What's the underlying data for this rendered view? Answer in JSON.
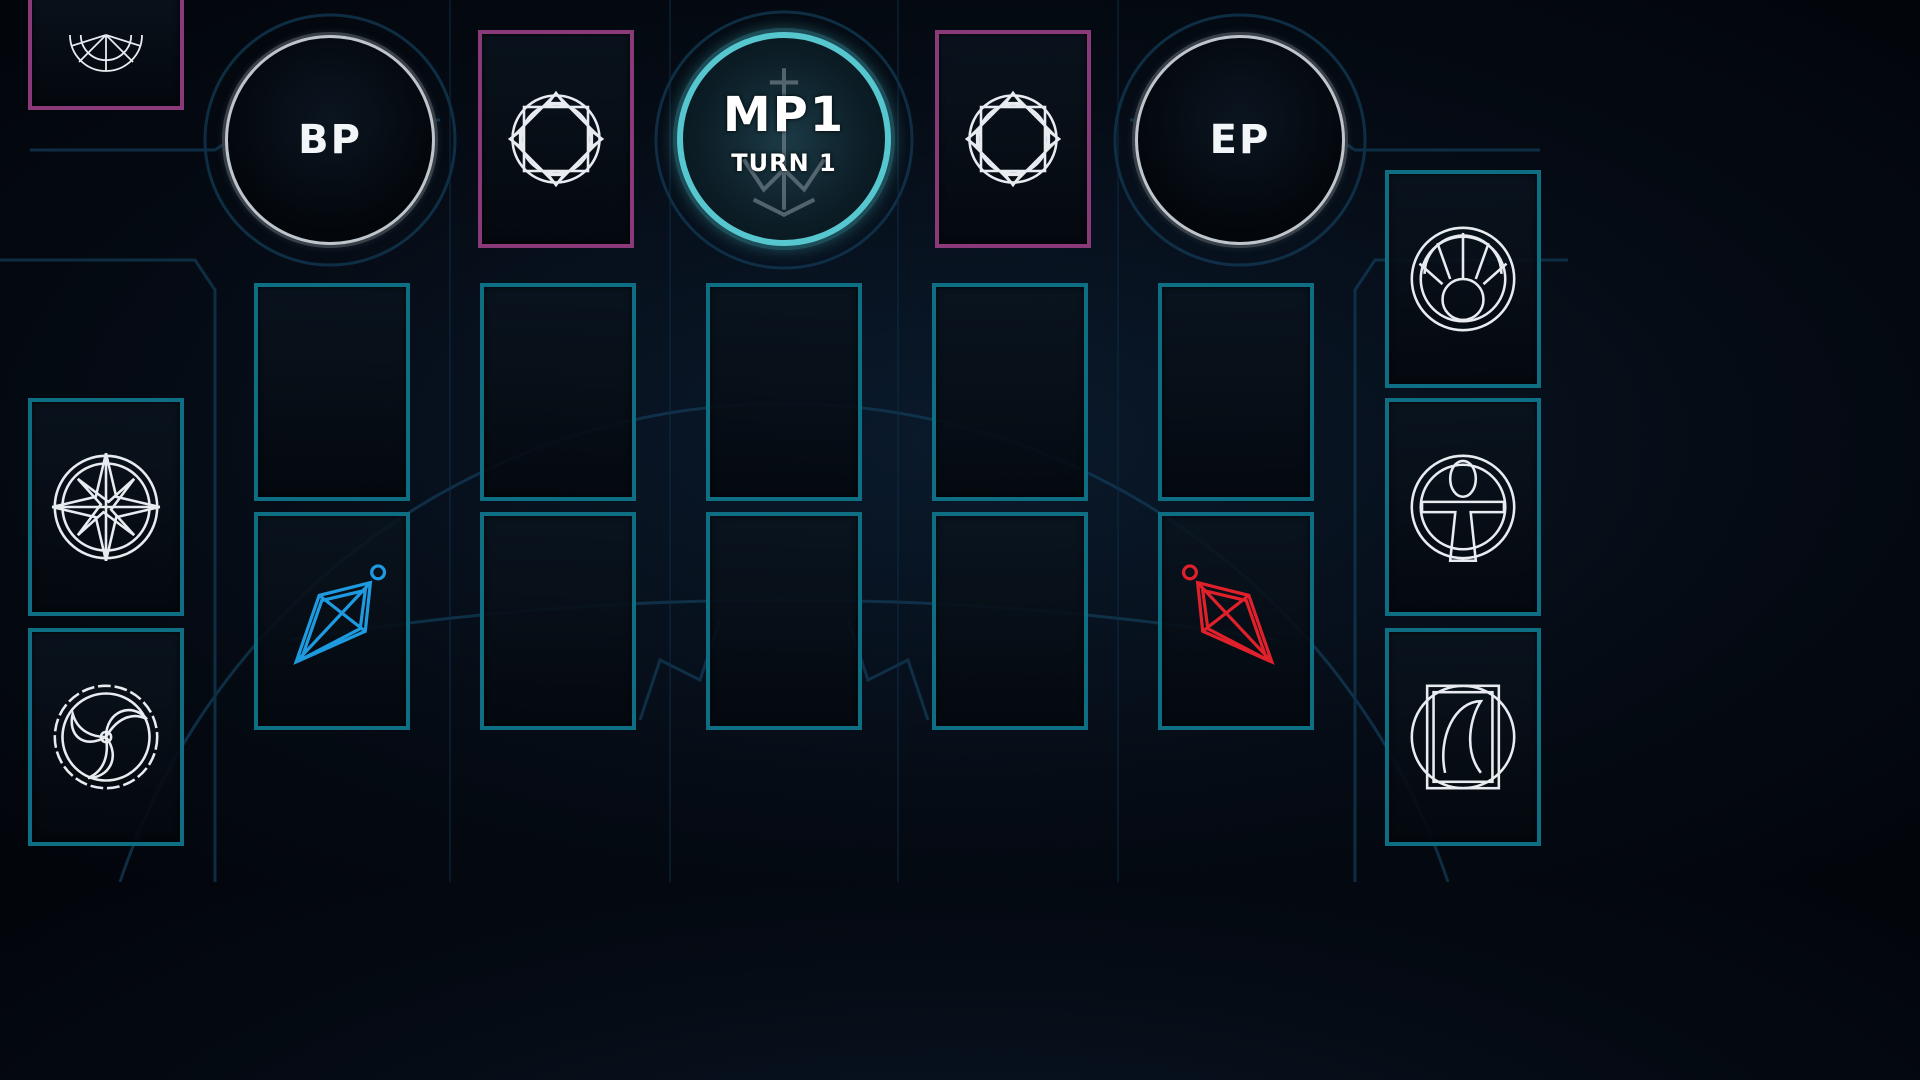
{
  "phases": {
    "left": "BP",
    "center_main": "MP1",
    "center_sub": "TURN 1",
    "right": "EP"
  },
  "colors": {
    "zone_border": "#0d6e84",
    "zone_pink_border": "#8a3a78",
    "player_link_arrow": "#1e9be0",
    "opponent_link_arrow": "#e0202a"
  },
  "icons": {
    "field_zone": "sundial-icon",
    "extra_deck_left": "octagram-icon",
    "extra_deck_right": "octagram-icon",
    "compass_zone": "compass-star-icon",
    "graveyard_zone": "tomoe-icon",
    "deck_zone_top": "sun-arch-icon",
    "banish_zone": "ankh-icon",
    "extra_zone_right": "deck-card-icon",
    "player_spell": "blue-pendulum-icon",
    "opponent_spell": "red-pendulum-icon"
  }
}
